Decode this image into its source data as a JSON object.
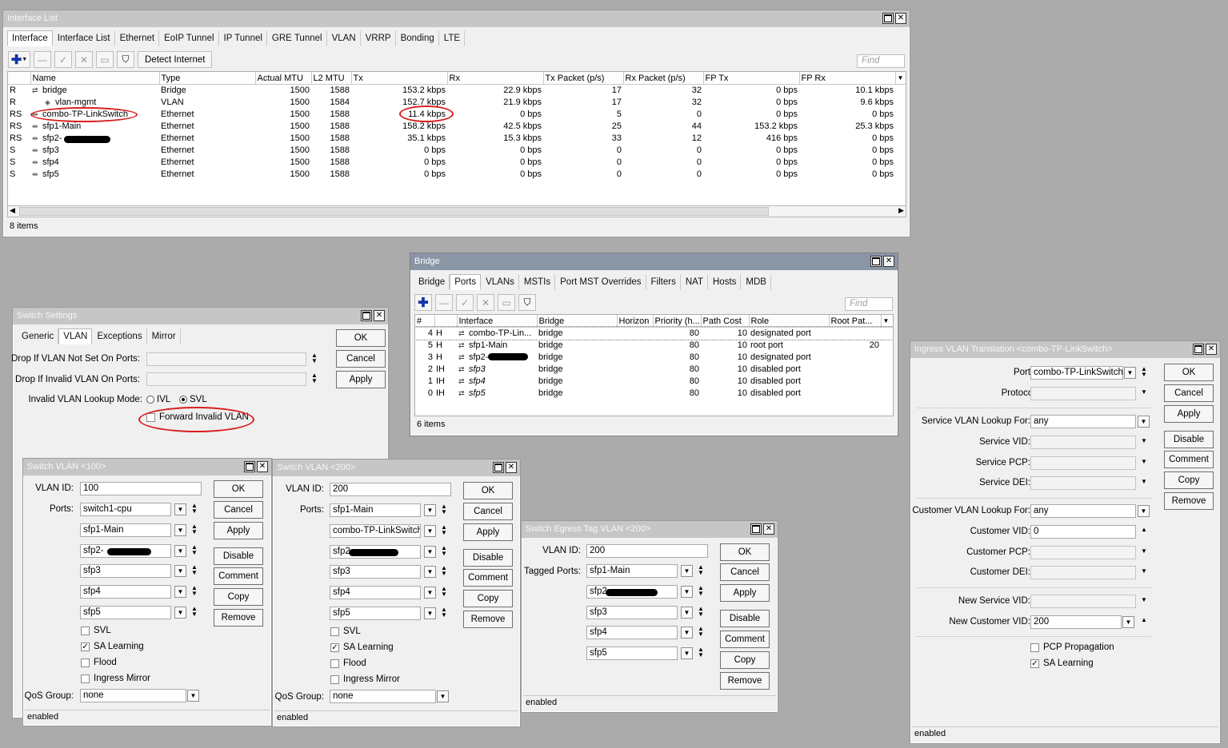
{
  "interface_window": {
    "title": "Interface List",
    "tabs": [
      "Interface",
      "Interface List",
      "Ethernet",
      "EoIP Tunnel",
      "IP Tunnel",
      "GRE Tunnel",
      "VLAN",
      "VRRP",
      "Bonding",
      "LTE"
    ],
    "detect_label": "Detect Internet",
    "find_placeholder": "Find",
    "columns": [
      "",
      "Name",
      "Type",
      "Actual MTU",
      "L2 MTU",
      "Tx",
      "Rx",
      "Tx Packet (p/s)",
      "Rx Packet (p/s)",
      "FP Tx",
      "FP Rx"
    ],
    "rows": [
      [
        "R",
        "bridge",
        "Bridge",
        "1500",
        "1588",
        "153.2 kbps",
        "22.9 kbps",
        "17",
        "32",
        "0 bps",
        "10.1 kbps"
      ],
      [
        "R",
        "vlan-mgmt",
        "VLAN",
        "1500",
        "1584",
        "152.7 kbps",
        "21.9 kbps",
        "17",
        "32",
        "0 bps",
        "9.6 kbps"
      ],
      [
        "RS",
        "combo-TP-LinkSwitch",
        "Ethernet",
        "1500",
        "1588",
        "11.4 kbps",
        "0 bps",
        "5",
        "0",
        "0 bps",
        "0 bps"
      ],
      [
        "RS",
        "sfp1-Main",
        "Ethernet",
        "1500",
        "1588",
        "158.2 kbps",
        "42.5 kbps",
        "25",
        "44",
        "153.2 kbps",
        "25.3 kbps"
      ],
      [
        "RS",
        "sfp2-",
        "Ethernet",
        "1500",
        "1588",
        "35.1 kbps",
        "15.3 kbps",
        "33",
        "12",
        "416 bps",
        "0 bps"
      ],
      [
        "S",
        "sfp3",
        "Ethernet",
        "1500",
        "1588",
        "0 bps",
        "0 bps",
        "0",
        "0",
        "0 bps",
        "0 bps"
      ],
      [
        "S",
        "sfp4",
        "Ethernet",
        "1500",
        "1588",
        "0 bps",
        "0 bps",
        "0",
        "0",
        "0 bps",
        "0 bps"
      ],
      [
        "S",
        "sfp5",
        "Ethernet",
        "1500",
        "1588",
        "0 bps",
        "0 bps",
        "0",
        "0",
        "0 bps",
        "0 bps"
      ]
    ],
    "status": "8 items"
  },
  "bridge_window": {
    "title": "Bridge",
    "tabs": [
      "Bridge",
      "Ports",
      "VLANs",
      "MSTIs",
      "Port MST Overrides",
      "Filters",
      "NAT",
      "Hosts",
      "MDB"
    ],
    "find_placeholder": "Find",
    "columns": [
      "#",
      "",
      "Interface",
      "Bridge",
      "Horizon",
      "Priority (h...",
      "Path Cost",
      "Role",
      "Root Pat..."
    ],
    "rows": [
      [
        "4",
        "H",
        "combo-TP-Lin...",
        "bridge",
        "",
        "80",
        "10",
        "designated port",
        ""
      ],
      [
        "5",
        "H",
        "sfp1-Main",
        "bridge",
        "",
        "80",
        "10",
        "root port",
        "20"
      ],
      [
        "3",
        "H",
        "sfp2-",
        "bridge",
        "",
        "80",
        "10",
        "designated port",
        ""
      ],
      [
        "2",
        "IH",
        "sfp3",
        "bridge",
        "",
        "80",
        "10",
        "disabled port",
        ""
      ],
      [
        "1",
        "IH",
        "sfp4",
        "bridge",
        "",
        "80",
        "10",
        "disabled port",
        ""
      ],
      [
        "0",
        "IH",
        "sfp5",
        "bridge",
        "",
        "80",
        "10",
        "disabled port",
        ""
      ]
    ],
    "status": "6 items"
  },
  "switch_settings": {
    "title": "Switch Settings",
    "tabs": [
      "Generic",
      "VLAN",
      "Exceptions",
      "Mirror"
    ],
    "drop_not_set_label": "Drop If VLAN Not Set On Ports:",
    "drop_invalid_label": "Drop If Invalid VLAN On Ports:",
    "lookup_mode_label": "Invalid VLAN Lookup Mode:",
    "ivl": "IVL",
    "svl": "SVL",
    "forward_invalid": "Forward Invalid VLAN",
    "ok": "OK",
    "cancel": "Cancel",
    "apply": "Apply"
  },
  "switch_vlan_100": {
    "title": "Switch VLAN <100>",
    "vlan_id_label": "VLAN ID:",
    "vlan_id": "100",
    "ports_label": "Ports:",
    "ports": [
      "switch1-cpu",
      "sfp1-Main",
      "sfp2-",
      "sfp3",
      "sfp4",
      "sfp5"
    ],
    "svl": "SVL",
    "sa_learning": "SA Learning",
    "flood": "Flood",
    "ingress_mirror": "Ingress Mirror",
    "qos_label": "QoS Group:",
    "qos": "none",
    "status": "enabled",
    "ok": "OK",
    "cancel": "Cancel",
    "apply": "Apply",
    "disable": "Disable",
    "comment": "Comment",
    "copy": "Copy",
    "remove": "Remove"
  },
  "switch_vlan_200": {
    "title": "Switch VLAN <200>",
    "vlan_id_label": "VLAN ID:",
    "vlan_id": "200",
    "ports_label": "Ports:",
    "ports": [
      "sfp1-Main",
      "combo-TP-LinkSwitch",
      "sfp2",
      "sfp3",
      "sfp4",
      "sfp5"
    ],
    "svl": "SVL",
    "sa_learning": "SA Learning",
    "flood": "Flood",
    "ingress_mirror": "Ingress Mirror",
    "qos_label": "QoS Group:",
    "qos": "none",
    "status": "enabled",
    "ok": "OK",
    "cancel": "Cancel",
    "apply": "Apply",
    "disable": "Disable",
    "comment": "Comment",
    "copy": "Copy",
    "remove": "Remove"
  },
  "egress_tag": {
    "title": "Switch Egress Tag VLAN <200>",
    "vlan_id_label": "VLAN ID:",
    "vlan_id": "200",
    "tagged_label": "Tagged Ports:",
    "ports": [
      "sfp1-Main",
      "sfp2",
      "sfp3",
      "sfp4",
      "sfp5"
    ],
    "status": "enabled",
    "ok": "OK",
    "cancel": "Cancel",
    "apply": "Apply",
    "disable": "Disable",
    "comment": "Comment",
    "copy": "Copy",
    "remove": "Remove"
  },
  "ingress_translation": {
    "title": "Ingress VLAN Translation <combo-TP-LinkSwitch>",
    "ports_label": "Ports:",
    "ports": "combo-TP-LinkSwitch",
    "protocol_label": "Protocol:",
    "svc_lookup_label": "Service VLAN Lookup For:",
    "svc_lookup": "any",
    "svc_vid_label": "Service VID:",
    "svc_pcp_label": "Service PCP:",
    "svc_dei_label": "Service DEI:",
    "cust_lookup_label": "Customer VLAN Lookup For:",
    "cust_lookup": "any",
    "cust_vid_label": "Customer VID:",
    "cust_vid": "0",
    "cust_pcp_label": "Customer PCP:",
    "cust_dei_label": "Customer DEI:",
    "new_svc_label": "New Service VID:",
    "new_cust_label": "New Customer VID:",
    "new_cust": "200",
    "pcp_prop": "PCP Propagation",
    "sa_learning": "SA Learning",
    "status": "enabled",
    "ok": "OK",
    "cancel": "Cancel",
    "apply": "Apply",
    "disable": "Disable",
    "comment": "Comment",
    "copy": "Copy",
    "remove": "Remove"
  },
  "colors": {
    "annotation": "#d81e1e",
    "active_title": "#8a96a6",
    "inactive_title": "#c6c6c6"
  }
}
